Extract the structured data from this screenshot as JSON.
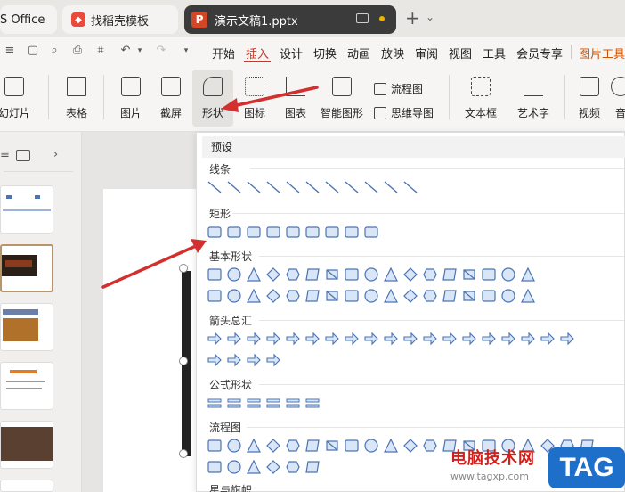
{
  "titlebar": {
    "tabs": [
      {
        "label": "S Office"
      },
      {
        "label": "找稻壳模板"
      },
      {
        "label": "演示文稿1.pptx"
      }
    ],
    "ppt_logo": "P"
  },
  "menu": {
    "items": [
      "开始",
      "插入",
      "设计",
      "切换",
      "动画",
      "放映",
      "审阅",
      "视图",
      "工具",
      "会员专享",
      "图片工具"
    ],
    "active": "插入"
  },
  "ribbon": {
    "buttons": [
      {
        "label": "幻灯片",
        "icon": "new-slide-icon"
      },
      {
        "label": "表格",
        "icon": "table-icon"
      },
      {
        "label": "图片",
        "icon": "image-icon"
      },
      {
        "label": "截屏",
        "icon": "screenshot-icon"
      },
      {
        "label": "形状",
        "icon": "shapes-icon"
      },
      {
        "label": "图标",
        "icon": "icon-library-icon"
      },
      {
        "label": "图表",
        "icon": "chart-icon"
      },
      {
        "label": "智能图形",
        "icon": "smartart-icon"
      },
      {
        "label": "文本框",
        "icon": "textbox-icon"
      },
      {
        "label": "艺术字",
        "icon": "wordart-icon"
      },
      {
        "label": "视频",
        "icon": "video-icon"
      },
      {
        "label": "音",
        "icon": "audio-icon"
      }
    ],
    "small_buttons": [
      {
        "label": "流程图",
        "icon": "flowchart-icon"
      },
      {
        "label": "思维导图",
        "icon": "mindmap-icon"
      }
    ]
  },
  "dropdown": {
    "header": "预设",
    "sections": [
      {
        "title": "线条",
        "count": 11
      },
      {
        "title": "矩形",
        "count": 9
      },
      {
        "title": "基本形状",
        "count": 34
      },
      {
        "title": "箭头总汇",
        "count": 23
      },
      {
        "title": "公式形状",
        "count": 6
      },
      {
        "title": "流程图",
        "count": 26
      },
      {
        "title": "星与旗帜",
        "count": 0
      }
    ]
  },
  "watermark": {
    "text": "电脑技术网",
    "url": "www.tagxp.com",
    "tag": "TAG"
  },
  "colors": {
    "accent": "#c0392b",
    "shape_fill": "#d9e6f7",
    "shape_stroke": "#4a74b5",
    "arrow": "#d32f2f"
  }
}
